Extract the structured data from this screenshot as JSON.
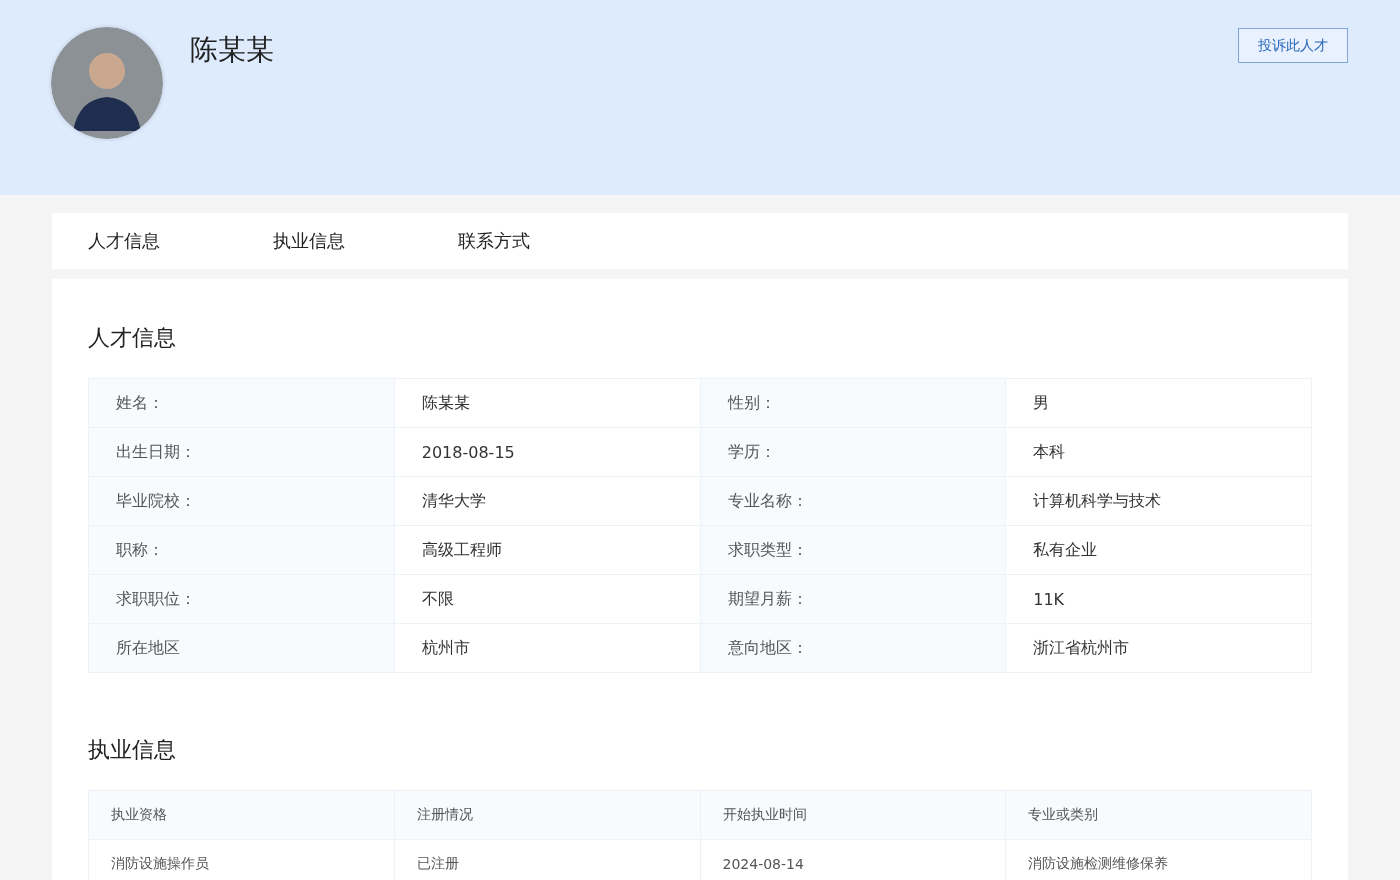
{
  "profile": {
    "name": "陈某某",
    "report_button": "投诉此人才"
  },
  "tabs": [
    {
      "label": "人才信息"
    },
    {
      "label": "执业信息"
    },
    {
      "label": "联系方式"
    }
  ],
  "talent_info": {
    "title": "人才信息",
    "rows": [
      {
        "label_1": "姓名：",
        "value_1": "陈某某",
        "label_2": "性别：",
        "value_2": "男"
      },
      {
        "label_1": "出生日期：",
        "value_1": "2018-08-15",
        "label_2": "学历：",
        "value_2": "本科"
      },
      {
        "label_1": "毕业院校：",
        "value_1": "清华大学",
        "label_2": "专业名称：",
        "value_2": "计算机科学与技术"
      },
      {
        "label_1": "职称：",
        "value_1": "高级工程师",
        "label_2": "求职类型：",
        "value_2": "私有企业"
      },
      {
        "label_1": "求职职位：",
        "value_1": "不限",
        "label_2": "期望月薪：",
        "value_2": "11K"
      },
      {
        "label_1": "所在地区",
        "value_1": "杭州市",
        "label_2": "意向地区：",
        "value_2": "浙江省杭州市"
      }
    ]
  },
  "practice_info": {
    "title": "执业信息",
    "columns": [
      "执业资格",
      "注册情况",
      "开始执业时间",
      "专业或类别"
    ],
    "rows": [
      [
        "消防设施操作员",
        "已注册",
        "2024-08-14",
        "消防设施检测维修保养"
      ]
    ]
  }
}
